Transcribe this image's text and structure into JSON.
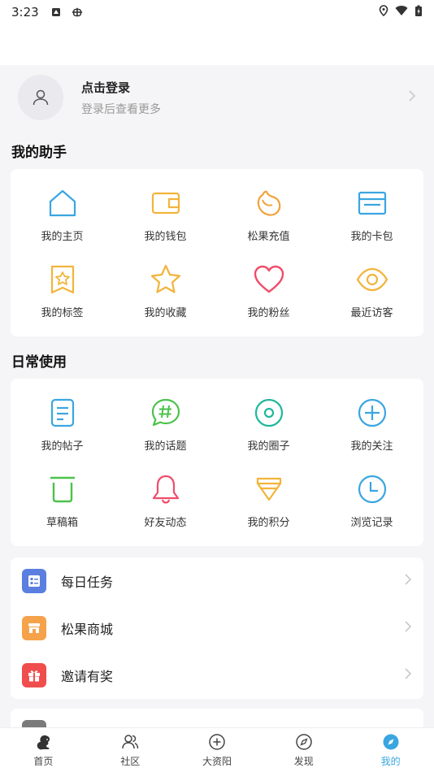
{
  "status_bar": {
    "time": "3:23"
  },
  "profile": {
    "title": "点击登录",
    "subtitle": "登录后查看更多"
  },
  "assistant": {
    "title": "我的助手",
    "items": [
      {
        "label": "我的主页",
        "icon": "home-icon"
      },
      {
        "label": "我的钱包",
        "icon": "wallet-icon"
      },
      {
        "label": "松果充值",
        "icon": "pinecone-icon"
      },
      {
        "label": "我的卡包",
        "icon": "card-icon"
      },
      {
        "label": "我的标签",
        "icon": "tag-icon"
      },
      {
        "label": "我的收藏",
        "icon": "star-icon"
      },
      {
        "label": "我的粉丝",
        "icon": "heart-icon"
      },
      {
        "label": "最近访客",
        "icon": "eye-icon"
      }
    ]
  },
  "daily": {
    "title": "日常使用",
    "items": [
      {
        "label": "我的帖子",
        "icon": "post-icon"
      },
      {
        "label": "我的话题",
        "icon": "topic-icon"
      },
      {
        "label": "我的圈子",
        "icon": "circle-icon"
      },
      {
        "label": "我的关注",
        "icon": "follow-icon"
      },
      {
        "label": "草稿箱",
        "icon": "draft-icon"
      },
      {
        "label": "好友动态",
        "icon": "bell-icon"
      },
      {
        "label": "我的积分",
        "icon": "points-icon"
      },
      {
        "label": "浏览记录",
        "icon": "history-icon"
      }
    ]
  },
  "list": [
    {
      "label": "每日任务",
      "icon": "task-icon",
      "color": "#5b7fe0"
    },
    {
      "label": "松果商城",
      "icon": "shop-icon",
      "color": "#f5a24b"
    },
    {
      "label": "邀请有奖",
      "icon": "gift-icon",
      "color": "#f04d4d"
    }
  ],
  "tabs": [
    {
      "label": "首页",
      "icon": "squirrel-icon"
    },
    {
      "label": "社区",
      "icon": "community-icon"
    },
    {
      "label": "大资阳",
      "icon": "plus-circle-icon"
    },
    {
      "label": "发现",
      "icon": "compass-icon"
    },
    {
      "label": "我的",
      "icon": "me-icon",
      "active": true
    }
  ],
  "colors": {
    "accent": "#3aa6e0",
    "blue": "#3aa6e0",
    "orange": "#f2b43a",
    "pink": "#f04d6a",
    "green": "#4cc24a",
    "teal": "#1fb89b"
  }
}
